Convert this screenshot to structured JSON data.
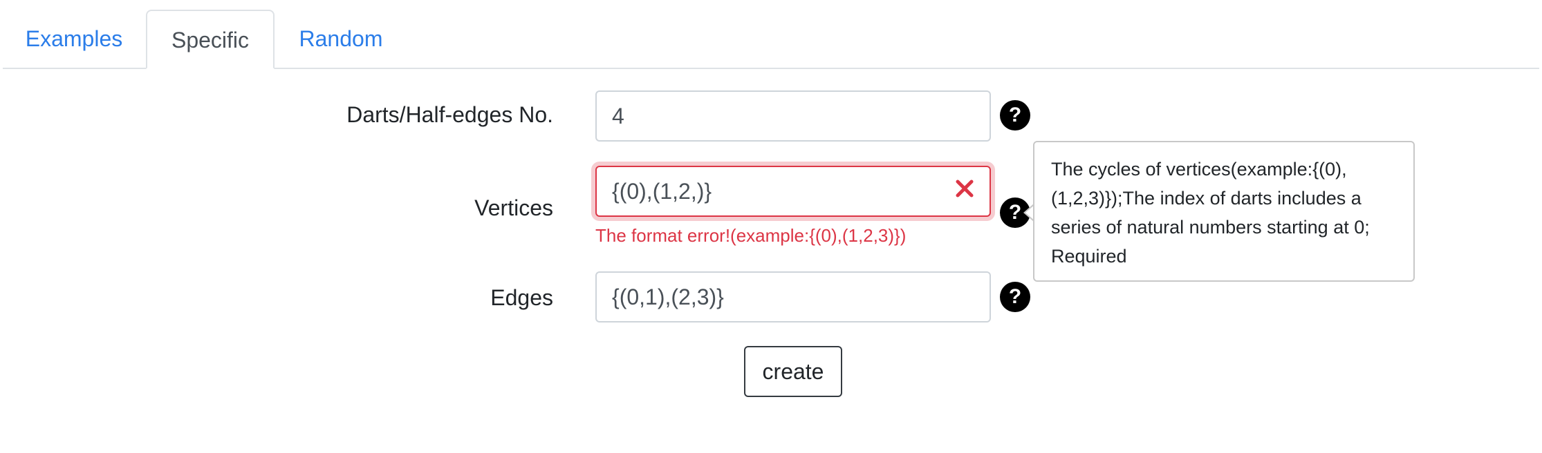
{
  "tabs": [
    {
      "label": "Examples",
      "active": false
    },
    {
      "label": "Specific",
      "active": true
    },
    {
      "label": "Random",
      "active": false
    }
  ],
  "form": {
    "darts": {
      "label": "Darts/Half-edges No.",
      "value": "4"
    },
    "vertices": {
      "label": "Vertices",
      "value": "{(0),(1,2,)}",
      "error": "The format error!(example:{(0),(1,2,3)})",
      "tooltip": "The cycles of vertices(example:{(0),(1,2,3)});The index of darts includes a series of natural numbers starting at 0; Required"
    },
    "edges": {
      "label": "Edges",
      "value": "{(0,1),(2,3)}"
    },
    "help_glyph": "?",
    "create_label": "create"
  },
  "colors": {
    "link": "#2b7de9",
    "error": "#dc3545",
    "border": "#ced4da"
  },
  "icons": {
    "help": "question-circle-icon",
    "clear": "close-x-icon"
  }
}
